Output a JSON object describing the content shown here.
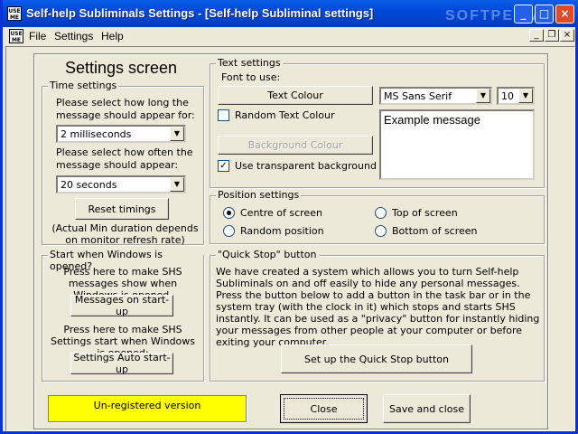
{
  "window": {
    "title": "Self-help Subliminals Settings - [Self-help Subliminal settings]",
    "app_icon": "USE ME",
    "watermark": "SOFTPEDIA"
  },
  "menubar": {
    "items": [
      "File",
      "Settings",
      "Help"
    ]
  },
  "page_heading": "Settings screen",
  "time_settings": {
    "label": "Time settings",
    "duration_prompt": "Please select how long the message should appear for:",
    "duration_value": "2 milliseconds",
    "frequency_prompt": "Please select how often the message should appear:",
    "frequency_value": "20 seconds",
    "reset_button": "Reset timings",
    "note": "(Actual Min duration depends on monitor refresh rate)"
  },
  "startup": {
    "label": "Start when Windows is opened?",
    "messages_prompt": "Press here to make SHS messages show when Windows is opened.",
    "messages_button": "Messages on start-up",
    "settings_prompt": "Press here to make SHS Settings start when Windows is opened:",
    "settings_button": "Settings Auto start-up"
  },
  "text_settings": {
    "label": "Text settings",
    "font_label": "Font to use:",
    "text_colour_button": "Text Colour",
    "random_text_colour": "Random Text Colour",
    "random_text_colour_checked": false,
    "background_colour_button": "Background Colour",
    "transparent_bg": "Use transparent background",
    "transparent_bg_checked": true,
    "font_value": "MS Sans Serif",
    "size_value": "10",
    "example": "Example message"
  },
  "position_settings": {
    "label": "Position settings",
    "options": [
      "Centre of screen",
      "Top of screen",
      "Random position",
      "Bottom of screen"
    ],
    "selected": "Centre of screen"
  },
  "quick_stop": {
    "label": "\"Quick Stop\" button",
    "description": "We have created a system which allows you to turn Self-help Subliminals on and off easily to hide any personal messages. Press the button below to add a button in the task bar or in the system tray (with the clock in it) which stops and starts SHS instantly. It can be used as a \"privacy\" button for instantly hiding your messages from other people at your computer or before exiting your computer.",
    "setup_button": "Set up the Quick Stop button"
  },
  "footer": {
    "registration": "Un-registered version",
    "close_button": "Close",
    "save_close_button": "Save and close"
  },
  "colors": {
    "titlebar": "#0054e3",
    "face": "#ece9d8",
    "unregistered_bg": "#ffff00"
  }
}
